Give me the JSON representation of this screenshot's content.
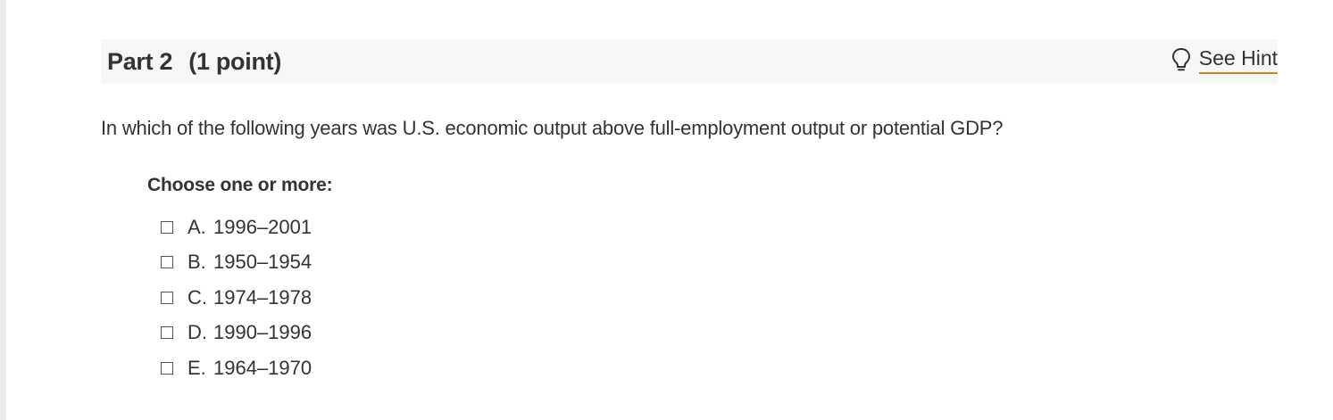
{
  "part": {
    "title": "Part 2",
    "points": "(1 point)",
    "hint_label": "See Hint",
    "hint_icon": "lightbulb-icon"
  },
  "question": {
    "text": "In which of the following years was U.S. economic output above full-employment output or potential GDP?"
  },
  "choices": {
    "label": "Choose one or more:",
    "options": [
      {
        "letter": "A.",
        "text": "1996–2001",
        "checked": false
      },
      {
        "letter": "B.",
        "text": "1950–1954",
        "checked": false
      },
      {
        "letter": "C.",
        "text": "1974–1978",
        "checked": false
      },
      {
        "letter": "D.",
        "text": "1990–1996",
        "checked": false
      },
      {
        "letter": "E.",
        "text": "1964–1970",
        "checked": false
      }
    ]
  },
  "colors": {
    "header_bg": "#f7f7f7",
    "text": "#333333",
    "hint_underline": "#c8861f",
    "left_rail": "#ebebeb"
  }
}
